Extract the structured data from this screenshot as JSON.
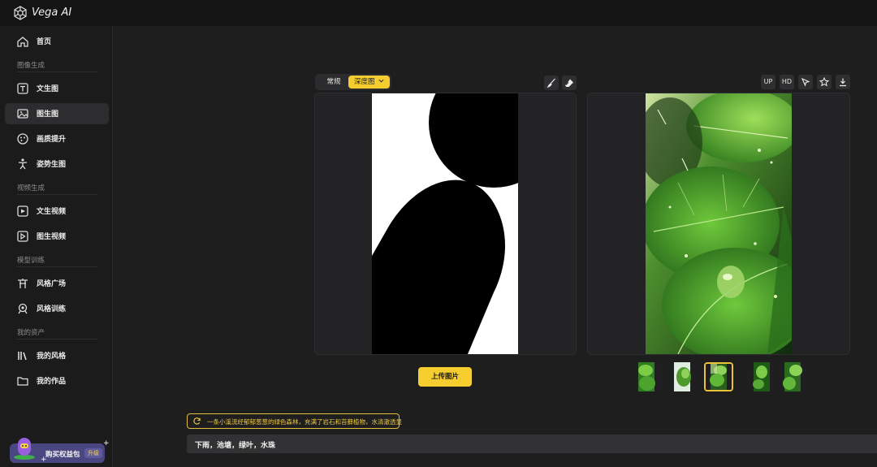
{
  "app": {
    "title": "Vega AI"
  },
  "sidebar": {
    "items": [
      {
        "label": "首页",
        "icon": "home-icon"
      },
      {
        "label": "文生图",
        "icon": "text-to-image-icon"
      },
      {
        "label": "图生图",
        "icon": "image-to-image-icon",
        "active": true
      },
      {
        "label": "画质提升",
        "icon": "enhance-icon"
      },
      {
        "label": "姿势生图",
        "icon": "pose-icon"
      },
      {
        "label": "文生视频",
        "icon": "text-to-video-icon"
      },
      {
        "label": "图生视频",
        "icon": "image-to-video-icon"
      },
      {
        "label": "风格广场",
        "icon": "style-square-icon"
      },
      {
        "label": "风格训练",
        "icon": "style-training-icon"
      },
      {
        "label": "我的风格",
        "icon": "my-styles-icon"
      },
      {
        "label": "我的作品",
        "icon": "my-works-icon"
      }
    ],
    "sections": [
      "图像生成",
      "视频生成",
      "模型训练",
      "我的资产"
    ],
    "promo": {
      "label": "购买权益包",
      "badge": "升级"
    }
  },
  "editor": {
    "mode_normal": "常规",
    "mode_depth": "深度图",
    "upload_label": "上传图片",
    "result_buttons": {
      "up": "UP",
      "hd": "HD"
    },
    "thumbnail_count": 5,
    "selected_thumbnail": 3
  },
  "prompt": {
    "suggestion": "一条小溪流经郁郁葱葱的绿色森林，充满了岩石和苔藓植物，水清澈透显",
    "text": "下雨，池塘，绿叶，水珠"
  },
  "colors": {
    "accent": "#f5cd2e",
    "background": "#1e1e1f",
    "sidebar": "#1b1b1c",
    "promo": "#4a4680"
  }
}
